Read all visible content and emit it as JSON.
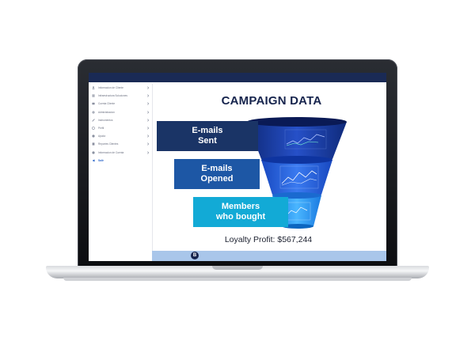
{
  "sidebar": {
    "items": [
      {
        "label": "Informacion de Cliente"
      },
      {
        "label": "Infraestructura Soluciones"
      },
      {
        "label": "Cuenta Cliente"
      },
      {
        "label": "Administracion"
      },
      {
        "label": "Instrumentos"
      },
      {
        "label": "Perfil"
      },
      {
        "label": "Ayuda"
      },
      {
        "label": "Reportes Clientes"
      },
      {
        "label": "Informacion de Cuenta"
      },
      {
        "label": "Salir"
      }
    ]
  },
  "slide": {
    "title": "CAMPAIGN DATA",
    "stages": [
      {
        "line1": "E-mails",
        "line2": "Sent"
      },
      {
        "line1": "E-mails",
        "line2": "Opened"
      },
      {
        "line1": "Members",
        "line2": "who bought"
      }
    ],
    "profit": "Loyalty Profit:  $567,244"
  },
  "info_button": {
    "label": "B"
  },
  "colors": {
    "navy": "#16244d",
    "stage_sent": "#1a3466",
    "stage_opened": "#1d57a5",
    "stage_bought": "#12aad6",
    "bottom_bar": "#a9c6ea"
  }
}
